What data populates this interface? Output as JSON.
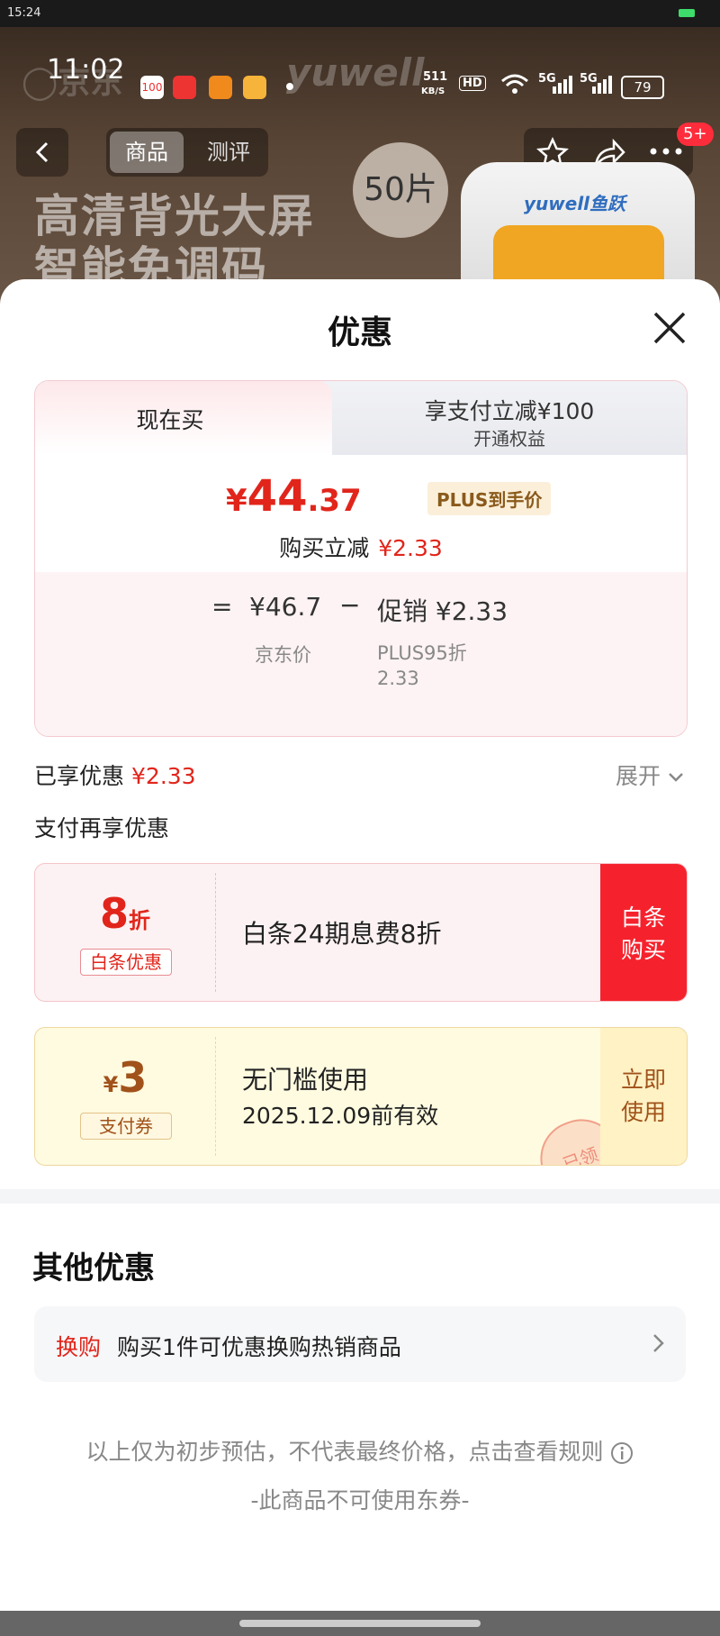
{
  "system": {
    "time": "15:24",
    "colors": {
      "battery": "#3ddc6b"
    }
  },
  "app_status": {
    "time": "11:02",
    "net_speed_top": "511",
    "net_speed_unit": "KB/S",
    "hd": "HD",
    "signal1": "5G",
    "signal2": "5G",
    "battery": "79",
    "icons": [
      "jd-100-icon",
      "piggy-icon",
      "calendar-icon",
      "orange-app-icon"
    ]
  },
  "header": {
    "back_icon": "chevron-left-icon",
    "tabs": [
      {
        "label": "商品"
      },
      {
        "label": "测评"
      }
    ],
    "star_icon": "star-icon",
    "share_icon": "share-icon",
    "more_icon": "more-icon",
    "more_badge": "5+"
  },
  "hero": {
    "line1": "高清背光大屏",
    "line2": "智能免调码",
    "pill": "50片",
    "device_brand": "yuwell鱼跃",
    "brand_watermark": "yuwell"
  },
  "sheet": {
    "title": "优惠",
    "close_icon": "close-icon",
    "price_card": {
      "tab_now": "现在买",
      "tab_pay_line1": "享支付立减¥100",
      "tab_pay_line2": "开通权益",
      "final_price_yen": "¥",
      "final_price_int": "44",
      "final_price_dec": ".37",
      "plus_tag": "PLUS到手价",
      "reduce_label": "购买立减",
      "reduce_value": "¥2.33",
      "equals": "=",
      "jd_price": "¥46.7",
      "minus": "−",
      "promo": "促销 ¥2.33",
      "jd_price_label": "京东价",
      "promo_label_1": "PLUS95折",
      "promo_label_2": "2.33"
    },
    "enjoyed_label": "已享优惠",
    "enjoyed_value": "¥2.33",
    "expand_label": "展开",
    "pay_more_label": "支付再享优惠",
    "coupons": [
      {
        "big": "8",
        "big_unit": "折",
        "tag": "白条优惠",
        "text": "白条24期息费8折",
        "btn_line1": "白条",
        "btn_line2": "购买",
        "accent": "#e1251b"
      },
      {
        "big_prefix": "¥",
        "big": "3",
        "tag": "支付券",
        "text": "无门槛使用",
        "subtext": "2025.12.09前有效",
        "btn_line1": "立即",
        "btn_line2": "使用",
        "stamp": "已领",
        "accent": "#a0521a"
      }
    ],
    "other_title": "其他优惠",
    "swap": {
      "tag": "换购",
      "text": "购买1件可优惠换购热销商品",
      "chevron_icon": "chevron-right-icon"
    },
    "note": "以上仅为初步预估，不代表最终价格，点击查看规则",
    "info_icon": "info-icon",
    "note2": "-此商品不可使用东券-"
  }
}
